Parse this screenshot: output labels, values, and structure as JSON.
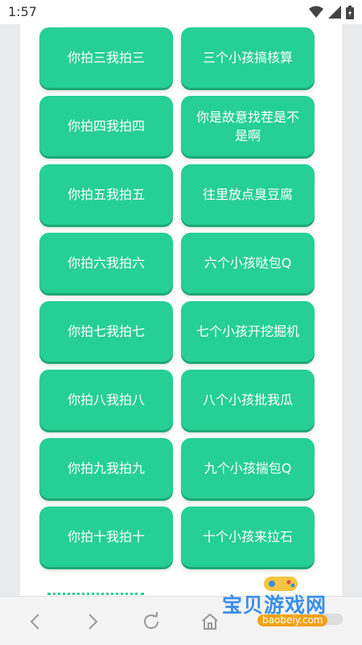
{
  "status": {
    "time": "1:57"
  },
  "cards": [
    {
      "label": "你拍三我拍三"
    },
    {
      "label": "三个小孩搞核算"
    },
    {
      "label": "你拍四我拍四"
    },
    {
      "label": "你是故意找茬是不是啊"
    },
    {
      "label": "你拍五我拍五"
    },
    {
      "label": "往里放点臭豆腐"
    },
    {
      "label": "你拍六我拍六"
    },
    {
      "label": "六个小孩哒包Q"
    },
    {
      "label": "你拍七我拍七"
    },
    {
      "label": "七个小孩开挖掘机"
    },
    {
      "label": "你拍八我拍八"
    },
    {
      "label": "八个小孩批我瓜"
    },
    {
      "label": "你拍九我拍九"
    },
    {
      "label": "九个小孩揣包Q"
    },
    {
      "label": "你拍十我拍十"
    },
    {
      "label": "十个小孩来拉石"
    }
  ],
  "watermark": {
    "name": "宝贝游戏网",
    "url": "baobeiy.com"
  },
  "colors": {
    "accent": "#26cf95"
  },
  "nav": {
    "icons": [
      "back-icon",
      "forward-icon",
      "refresh-icon",
      "home-icon"
    ]
  }
}
